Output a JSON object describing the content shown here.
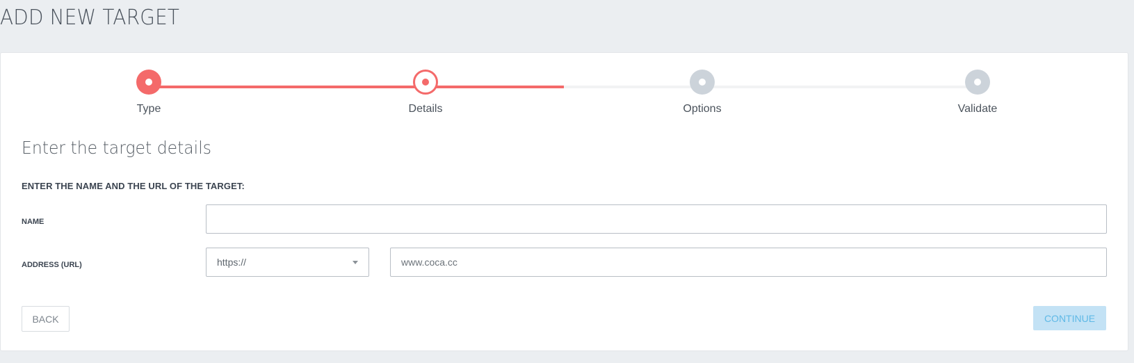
{
  "page": {
    "title": "ADD NEW TARGET"
  },
  "stepper": {
    "steps": [
      {
        "label": "Type",
        "state": "done"
      },
      {
        "label": "Details",
        "state": "active"
      },
      {
        "label": "Options",
        "state": "todo"
      },
      {
        "label": "Validate",
        "state": "todo"
      }
    ],
    "accent_color": "#f46a6a",
    "inactive_color": "#ccd3da"
  },
  "form": {
    "section_title": "Enter the target details",
    "instruction": "ENTER THE NAME AND THE URL OF THE TARGET:",
    "name": {
      "label": "NAME",
      "value": ""
    },
    "address": {
      "label": "ADDRESS (URL)",
      "protocol": "https://",
      "value": "www.coca.cc"
    }
  },
  "actions": {
    "back_label": "BACK",
    "continue_label": "CONTINUE"
  }
}
